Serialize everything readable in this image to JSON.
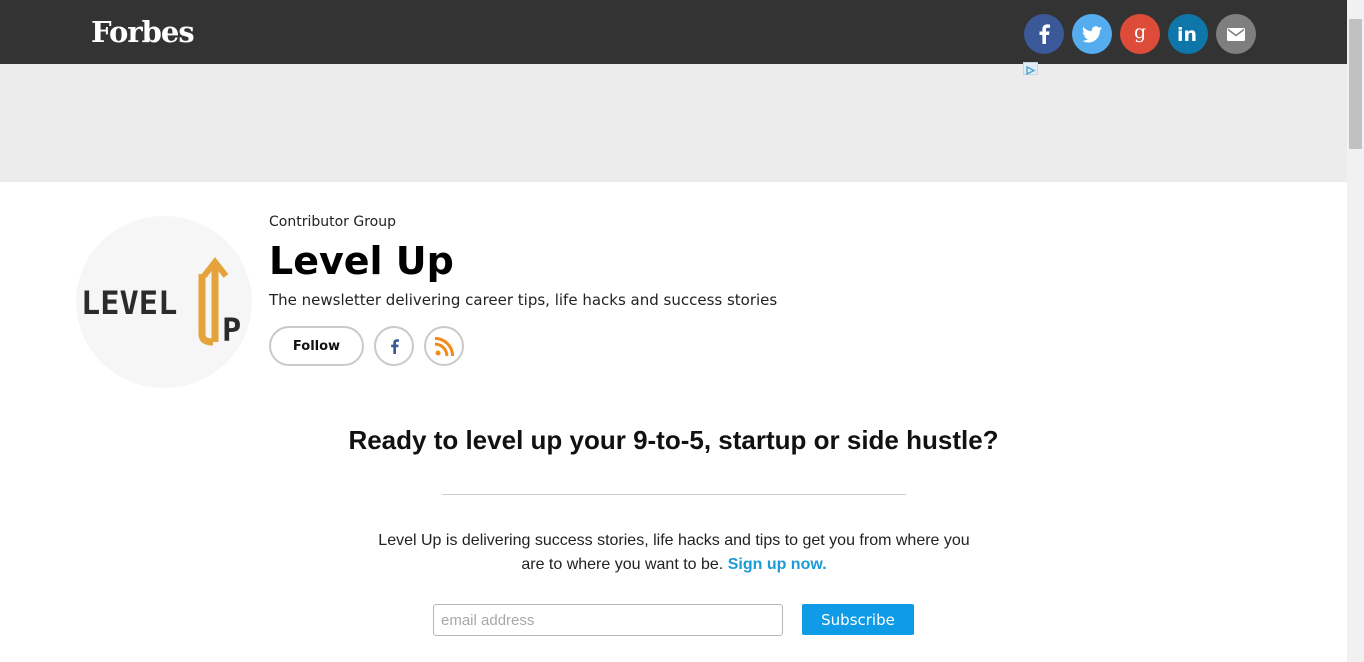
{
  "header": {
    "logo": "Forbes",
    "share_buttons": [
      {
        "icon": "facebook-icon",
        "color": "#3b5998"
      },
      {
        "icon": "twitter-icon",
        "color": "#55acee"
      },
      {
        "icon": "google-plus-icon",
        "color": "#dd4b39"
      },
      {
        "icon": "linkedin-icon",
        "color": "#0e76a8"
      },
      {
        "icon": "email-icon",
        "color": "#7f7f7f"
      }
    ]
  },
  "profile": {
    "group_label": "Contributor Group",
    "title": "Level Up",
    "tagline": "The newsletter delivering career tips, life hacks and success stories",
    "follow_label": "Follow",
    "logo_text": "LEVEL",
    "logo_text_2": "P",
    "accent_color": "#e5a33b"
  },
  "promo": {
    "heading": "Ready to level up your 9-to-5, startup or side hustle?",
    "body": "Level Up is delivering success stories, life hacks and tips to get you from where you are to where you want to be.",
    "signup_link": "Sign up now.",
    "email_placeholder": "email address",
    "subscribe_label": "Subscribe"
  }
}
